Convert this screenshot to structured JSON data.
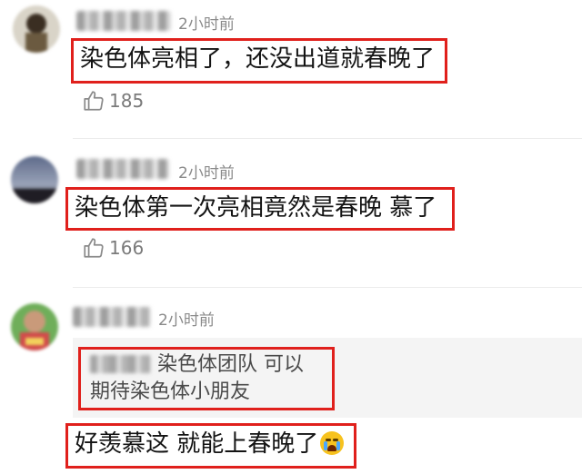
{
  "comments": [
    {
      "time": "2小时前",
      "text": "染色体亮相了，还没出道就春晚了",
      "likes": "185"
    },
    {
      "time": "2小时前",
      "text": "染色体第一次亮相竟然是春晚 慕了",
      "likes": "166"
    },
    {
      "time": "2小时前",
      "reply": {
        "line1": "染色体团队 可以",
        "line2": "期待染色体小朋友"
      },
      "text": "好羡慕这 就能上春晚了"
    }
  ],
  "icons": {
    "like": "thumbs-up-icon",
    "emoji": "crying-face-emoji-icon"
  },
  "colors": {
    "highlight_border": "#e0201c",
    "meta_text": "#8a8a8a"
  }
}
